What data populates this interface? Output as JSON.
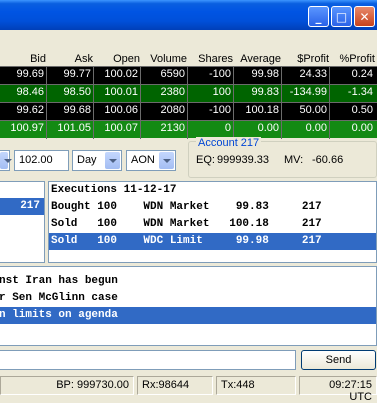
{
  "window": {
    "minimize_glyph": "_",
    "maximize_glyph": "□",
    "close_glyph": "✕"
  },
  "grid": {
    "headers": [
      "Bid",
      "Ask",
      "Open",
      "Volume",
      "Shares",
      "Average",
      "$Profit",
      "%Profit"
    ],
    "rows": [
      {
        "bid": "99.69",
        "ask": "99.77",
        "open": "100.02",
        "volume": "6590",
        "shares": "-100",
        "average": "99.98",
        "profit": "24.33",
        "pct": "0.24",
        "bg": "#000000",
        "fg": "#ffffff"
      },
      {
        "bid": "98.46",
        "ask": "98.50",
        "open": "100.01",
        "volume": "2380",
        "shares": "100",
        "average": "99.83",
        "profit": "-134.99",
        "pct": "-1.34",
        "bg": "#006400",
        "fg": "#ffffff"
      },
      {
        "bid": "99.62",
        "ask": "99.68",
        "open": "100.06",
        "volume": "2080",
        "shares": "-100",
        "average": "100.18",
        "profit": "50.00",
        "pct": "0.50",
        "bg": "#000000",
        "fg": "#ffffff"
      },
      {
        "bid": "100.97",
        "ask": "101.05",
        "open": "100.07",
        "volume": "2130",
        "shares": "0",
        "average": "0.00",
        "profit": "0.00",
        "pct": "0.00",
        "bg": "#138a13",
        "fg": "#ffffff"
      }
    ]
  },
  "order": {
    "price": "102.00",
    "tif": "Day",
    "type": "AON"
  },
  "account": {
    "title": "Account 217",
    "eq_label": "EQ:",
    "eq_value": "999939.33",
    "mv_label": "MV:",
    "mv_value": "-60.66"
  },
  "left_list": {
    "selected": "217"
  },
  "executions": {
    "title": "Executions 11-12-17",
    "lines": [
      "Bought 100    WDN Market    99.83     217",
      "Sold   100    WDN Market   100.18     217",
      "Sold   100    WDC Limit     99.98     217"
    ]
  },
  "news": {
    "lines": [
      "nst Iran has begun",
      "r Sen McGlinn case",
      "n limits on agenda"
    ]
  },
  "chat": {
    "input_value": "",
    "send_label": "Send"
  },
  "status": {
    "bp": "BP: 999730.00",
    "rx": "Rx:98644",
    "tx": "Tx:448",
    "time": "09:27:15 UTC"
  }
}
